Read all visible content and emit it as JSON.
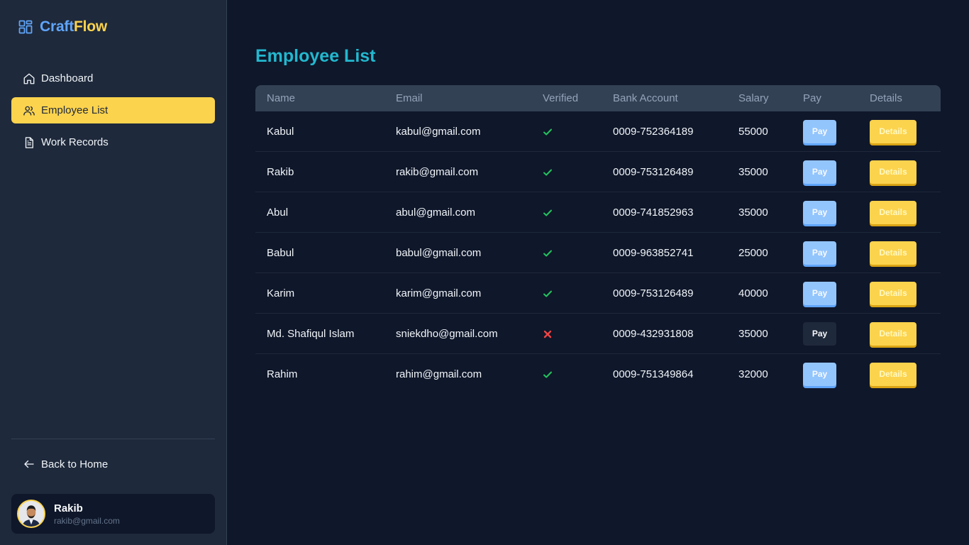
{
  "brand": {
    "name_part1": "Craft",
    "name_part2": "Flow",
    "color_primary": "#60a5fa",
    "color_accent": "#fcd34d"
  },
  "sidebar": {
    "items": [
      {
        "label": "Dashboard",
        "icon": "home-icon",
        "active": false
      },
      {
        "label": "Employee List",
        "icon": "users-icon",
        "active": true
      },
      {
        "label": "Work Records",
        "icon": "document-icon",
        "active": false
      }
    ],
    "back_label": "Back to Home"
  },
  "user": {
    "name": "Rakib",
    "email": "rakib@gmail.com"
  },
  "page": {
    "title": "Employee List"
  },
  "table": {
    "columns": [
      "Name",
      "Email",
      "Verified",
      "Bank Account",
      "Salary",
      "Pay",
      "Details"
    ],
    "pay_label": "Pay",
    "details_label": "Details",
    "rows": [
      {
        "name": "Kabul",
        "email": "kabul@gmail.com",
        "verified": true,
        "bank": "0009-752364189",
        "salary": "55000"
      },
      {
        "name": "Rakib",
        "email": "rakib@gmail.com",
        "verified": true,
        "bank": "0009-753126489",
        "salary": "35000"
      },
      {
        "name": "Abul",
        "email": "abul@gmail.com",
        "verified": true,
        "bank": "0009-741852963",
        "salary": "35000"
      },
      {
        "name": "Babul",
        "email": "babul@gmail.com",
        "verified": true,
        "bank": "0009-963852741",
        "salary": "25000"
      },
      {
        "name": "Karim",
        "email": "karim@gmail.com",
        "verified": true,
        "bank": "0009-753126489",
        "salary": "40000"
      },
      {
        "name": "Md. Shafiqul Islam",
        "email": "sniekdho@gmail.com",
        "verified": false,
        "bank": "0009-432931808",
        "salary": "35000"
      },
      {
        "name": "Rahim",
        "email": "rahim@gmail.com",
        "verified": true,
        "bank": "0009-751349864",
        "salary": "32000"
      }
    ]
  }
}
